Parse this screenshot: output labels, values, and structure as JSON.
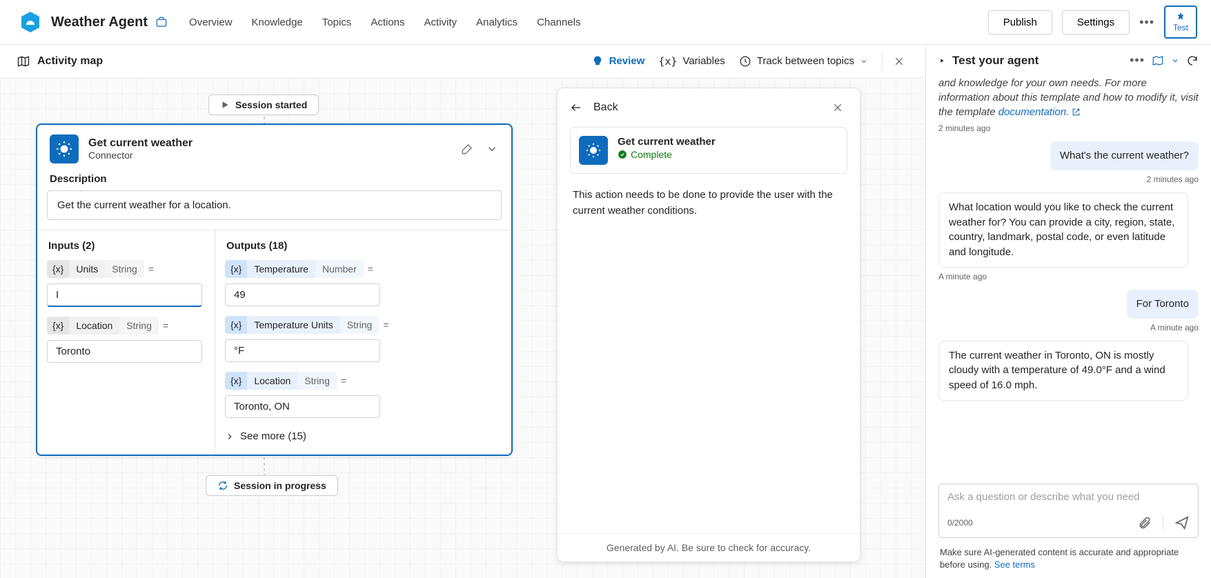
{
  "header": {
    "app_title": "Weather Agent",
    "tabs": [
      "Overview",
      "Knowledge",
      "Topics",
      "Actions",
      "Activity",
      "Analytics",
      "Channels"
    ],
    "publish": "Publish",
    "settings": "Settings",
    "test": "Test"
  },
  "toolbar": {
    "title": "Activity map",
    "review": "Review",
    "variables": "Variables",
    "track": "Track between topics"
  },
  "canvas": {
    "session_started": "Session started",
    "session_progress": "Session in progress"
  },
  "connector": {
    "title": "Get current weather",
    "subtitle": "Connector",
    "desc_label": "Description",
    "description": "Get the current weather for a location.",
    "inputs_label": "Inputs (2)",
    "outputs_label": "Outputs (18)",
    "inputs": [
      {
        "name": "Units",
        "type": "String",
        "value": "I"
      },
      {
        "name": "Location",
        "type": "String",
        "value": "Toronto"
      }
    ],
    "outputs": [
      {
        "name": "Temperature",
        "type": "Number",
        "value": "49"
      },
      {
        "name": "Temperature Units",
        "type": "String",
        "value": "°F"
      },
      {
        "name": "Location",
        "type": "String",
        "value": "Toronto, ON"
      }
    ],
    "see_more": "See more (15)"
  },
  "details": {
    "back": "Back",
    "title": "Get current weather",
    "status": "Complete",
    "body": "This action needs to be done to provide the user with the current weather conditions.",
    "footer": "Generated by AI. Be sure to check for accuracy."
  },
  "test": {
    "title": "Test your agent",
    "intro": "and knowledge for your own needs. For more information about this template and how to modify it, visit the template ",
    "doc_link": "documentation.",
    "ts1": "2 minutes ago",
    "m1": "What's the current weather?",
    "ts2": "2 minutes ago",
    "m2": "What location would you like to check the current weather for? You can provide a city, region, state, country, landmark, postal code, or even latitude and longitude.",
    "ts3": "A minute ago",
    "m3": "For Toronto",
    "ts4": "A minute ago",
    "m4": "The current weather in Toronto, ON is mostly cloudy with a temperature of 49.0°F and a wind speed of 16.0 mph.",
    "input_placeholder": "Ask a question or describe what you need",
    "char_count": "0/2000",
    "disclaimer_a": "Make sure AI-generated content is accurate and appropriate before using. ",
    "disclaimer_link": "See terms"
  }
}
